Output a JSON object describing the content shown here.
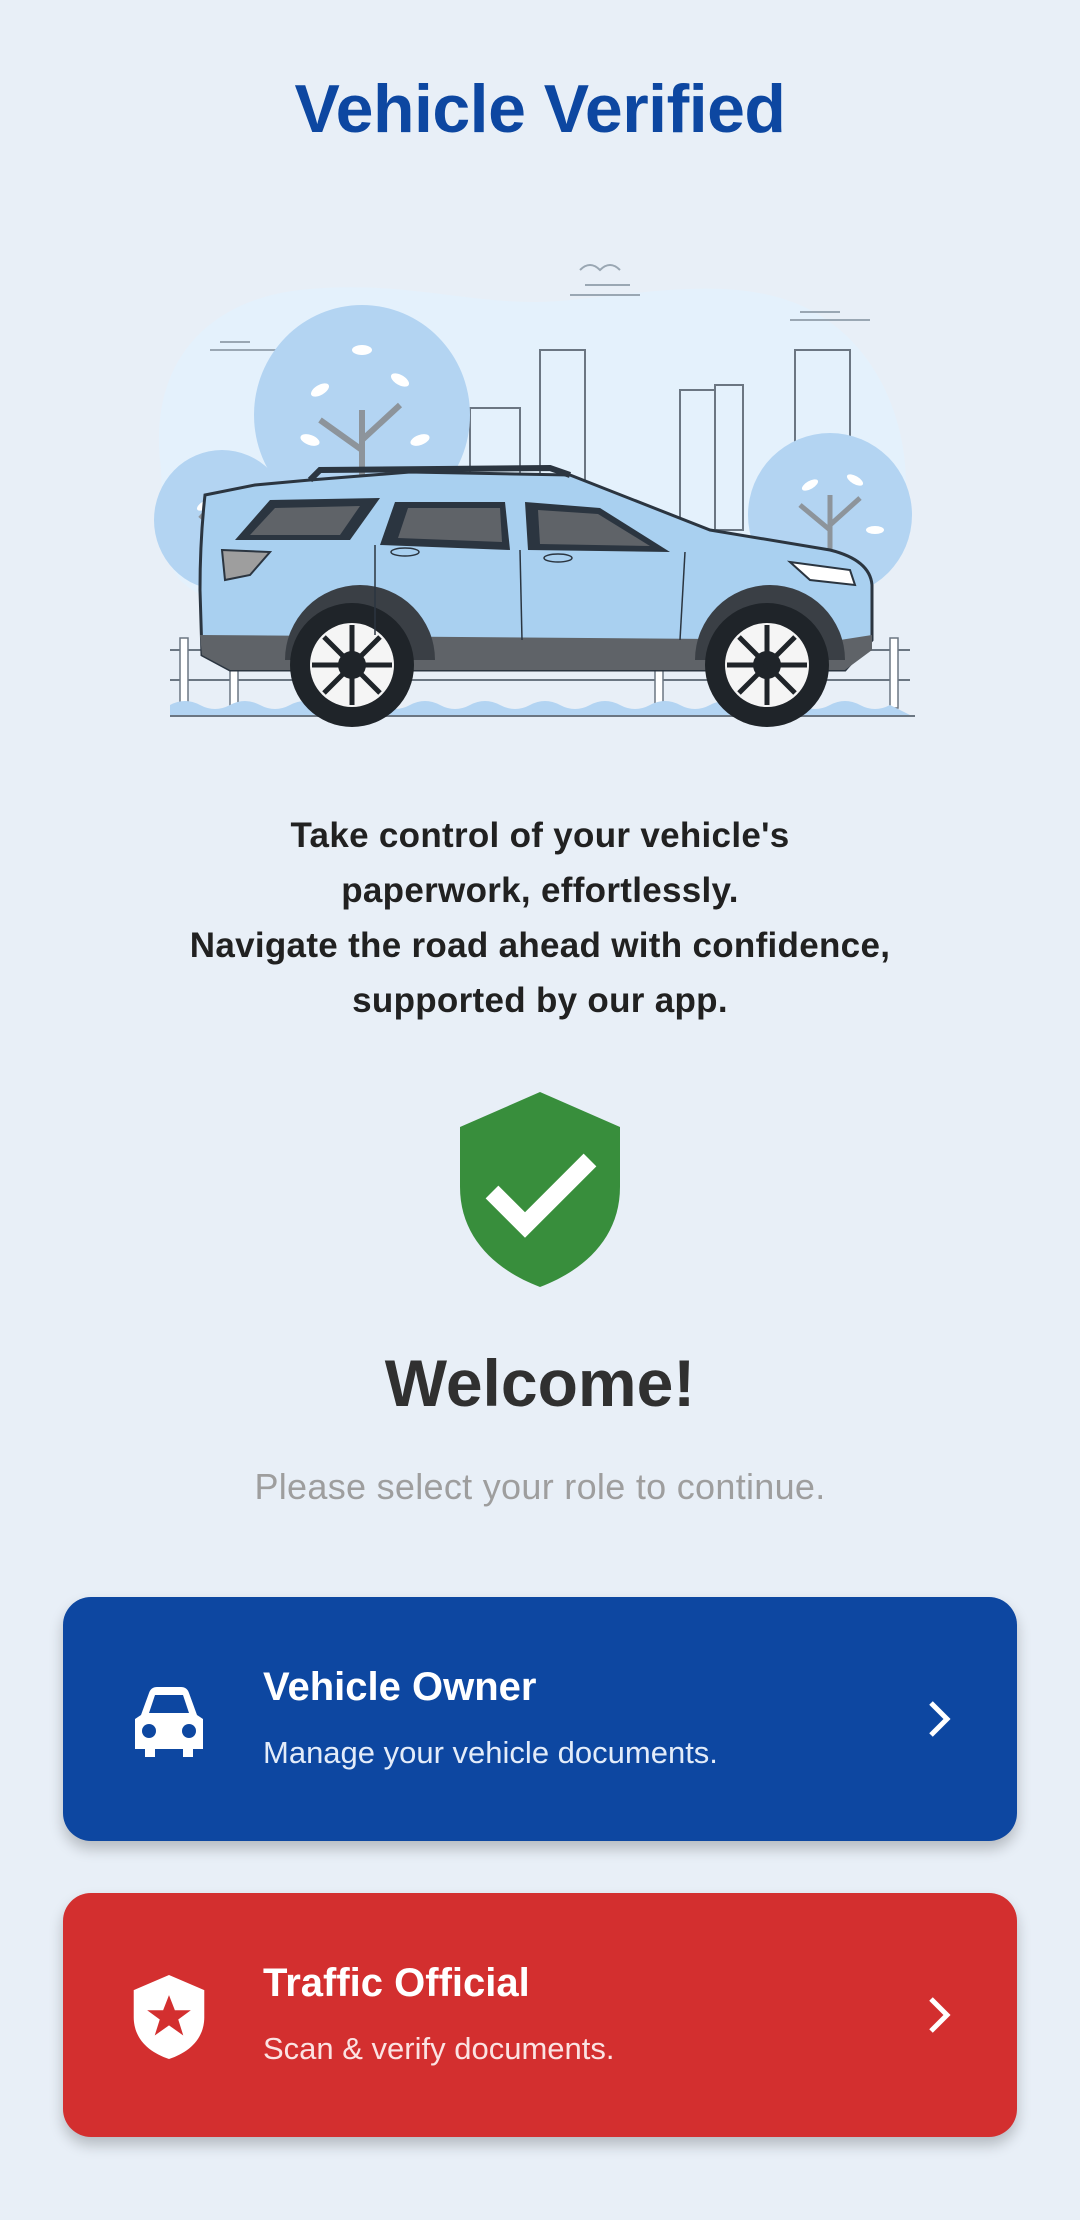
{
  "header": {
    "title": "Vehicle Verified"
  },
  "hero": {
    "illustration": "car-city-illustration"
  },
  "tagline": {
    "line1": "Take control of your vehicle's",
    "line2": "paperwork, effortlessly.",
    "line3": "Navigate the road ahead with confidence,",
    "line4": "supported by our app."
  },
  "status": {
    "icon": "verified-shield-icon",
    "color": "#388e3c"
  },
  "welcome": {
    "title": "Welcome!",
    "subtitle": "Please select your role to continue."
  },
  "roles": [
    {
      "title": "Vehicle Owner",
      "description": "Manage your vehicle documents.",
      "icon": "car-icon",
      "color": "#0d47a1"
    },
    {
      "title": "Traffic Official",
      "description": "Scan & verify documents.",
      "icon": "shield-star-icon",
      "color": "#d32f2f"
    }
  ],
  "colors": {
    "background": "#e8eff7",
    "primary": "#0d47a1",
    "danger": "#d32f2f",
    "success": "#388e3c"
  }
}
